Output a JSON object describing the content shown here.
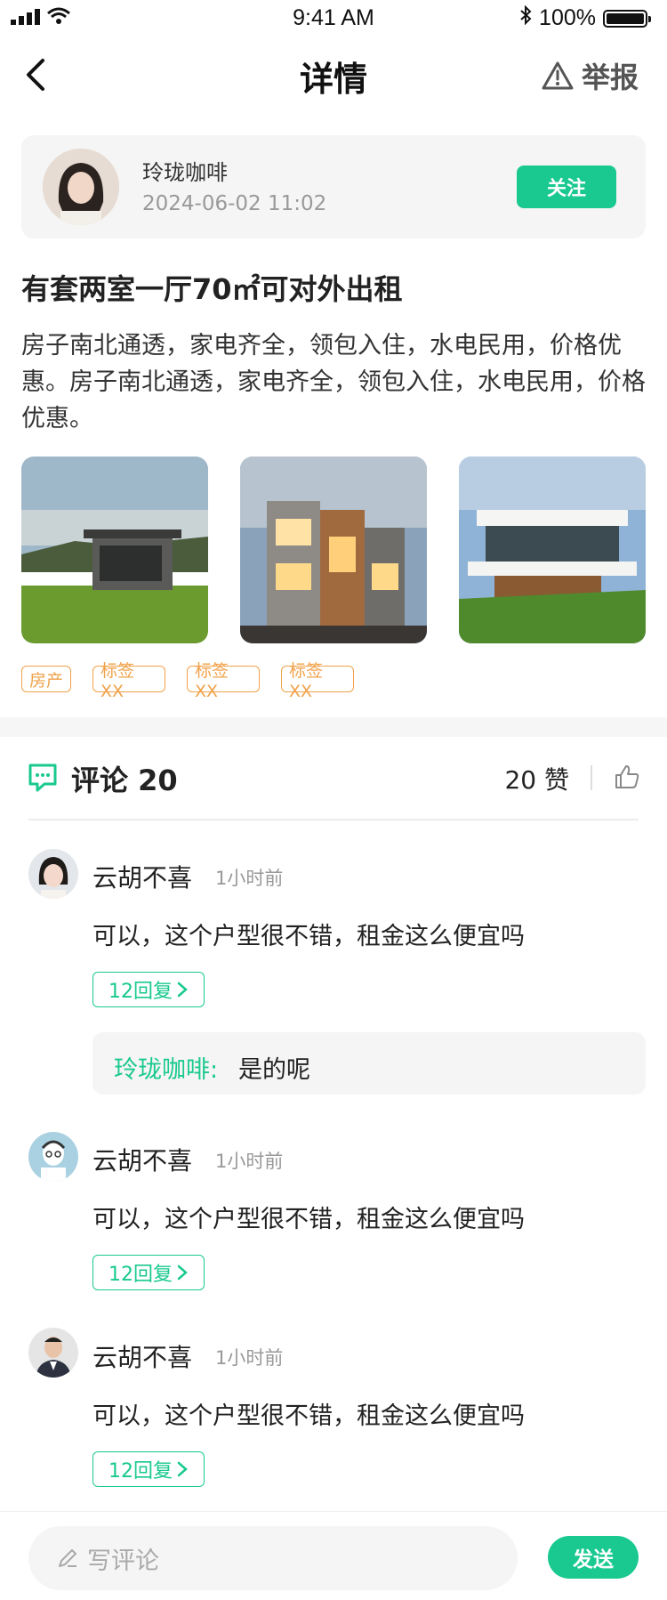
{
  "status_bar": {
    "time": "9:41 AM",
    "battery": "100%"
  },
  "nav": {
    "title": "详情",
    "report_label": "举报"
  },
  "author": {
    "name": "玲珑咖啡",
    "date": "2024-06-02 11:02",
    "follow_label": "关注"
  },
  "post": {
    "title": "有套两室一厅70㎡可对外出租",
    "body": "房子南北通透，家电齐全，领包入住，水电民用，价格优惠。房子南北通透，家电齐全，领包入住，水电民用，价格优惠。",
    "tags": [
      "房产",
      "标签XX",
      "标签XX",
      "标签XX"
    ]
  },
  "comments": {
    "title": "评论 20",
    "likes": "20 赞",
    "items": [
      {
        "name": "云胡不喜",
        "time": "1小时前",
        "text": "可以，这个户型很不错，租金这么便宜吗",
        "reply_label": "12回复",
        "reply_author": "玲珑咖啡:",
        "reply_text": "是的呢"
      },
      {
        "name": "云胡不喜",
        "time": "1小时前",
        "text": "可以，这个户型很不错，租金这么便宜吗",
        "reply_label": "12回复"
      },
      {
        "name": "云胡不喜",
        "time": "1小时前",
        "text": "可以，这个户型很不错，租金这么便宜吗",
        "reply_label": "12回复"
      }
    ]
  },
  "bottom_bar": {
    "placeholder": "写评论",
    "send_label": "发送"
  },
  "colors": {
    "accent": "#19c98f",
    "tag": "#f0a24a"
  }
}
